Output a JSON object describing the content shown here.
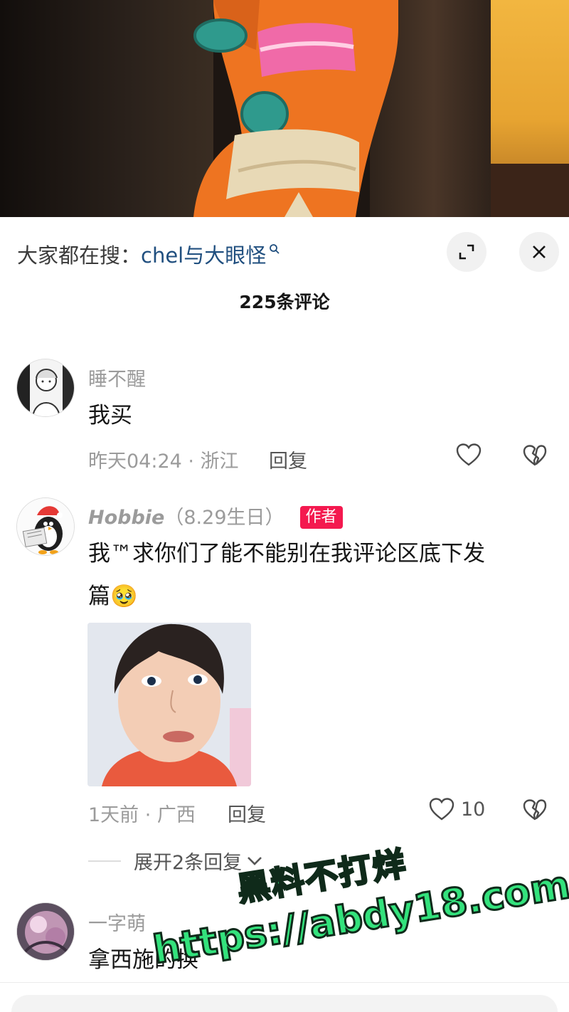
{
  "search": {
    "prefix": "大家都在搜：",
    "query": "chel与大眼怪"
  },
  "comment_count_label": "225条评论",
  "comments": [
    {
      "username": "睡不醒",
      "text": "我买",
      "time_location": "昨天04:24 · 浙江",
      "reply_label": "回复",
      "like_count": ""
    },
    {
      "username": "Hobbie",
      "username_note": "（8.29生日）",
      "badge": "作者",
      "text_line1": "我™求你们了能不能别在我评论区底下发",
      "text_line2": "篇",
      "emoji": "🥹",
      "time_location": "1天前 · 广西",
      "reply_label": "回复",
      "like_count": "10",
      "expand_replies_label": "展开2条回复"
    },
    {
      "username": "一字萌",
      "text": "拿西施的换"
    }
  ],
  "watermark": {
    "line1": "黑料不打烊",
    "line2": "https://abdy18.com"
  },
  "colors": {
    "accent_badge": "#f4194f",
    "search_query": "#204f7f",
    "watermark": "#33e27c"
  }
}
